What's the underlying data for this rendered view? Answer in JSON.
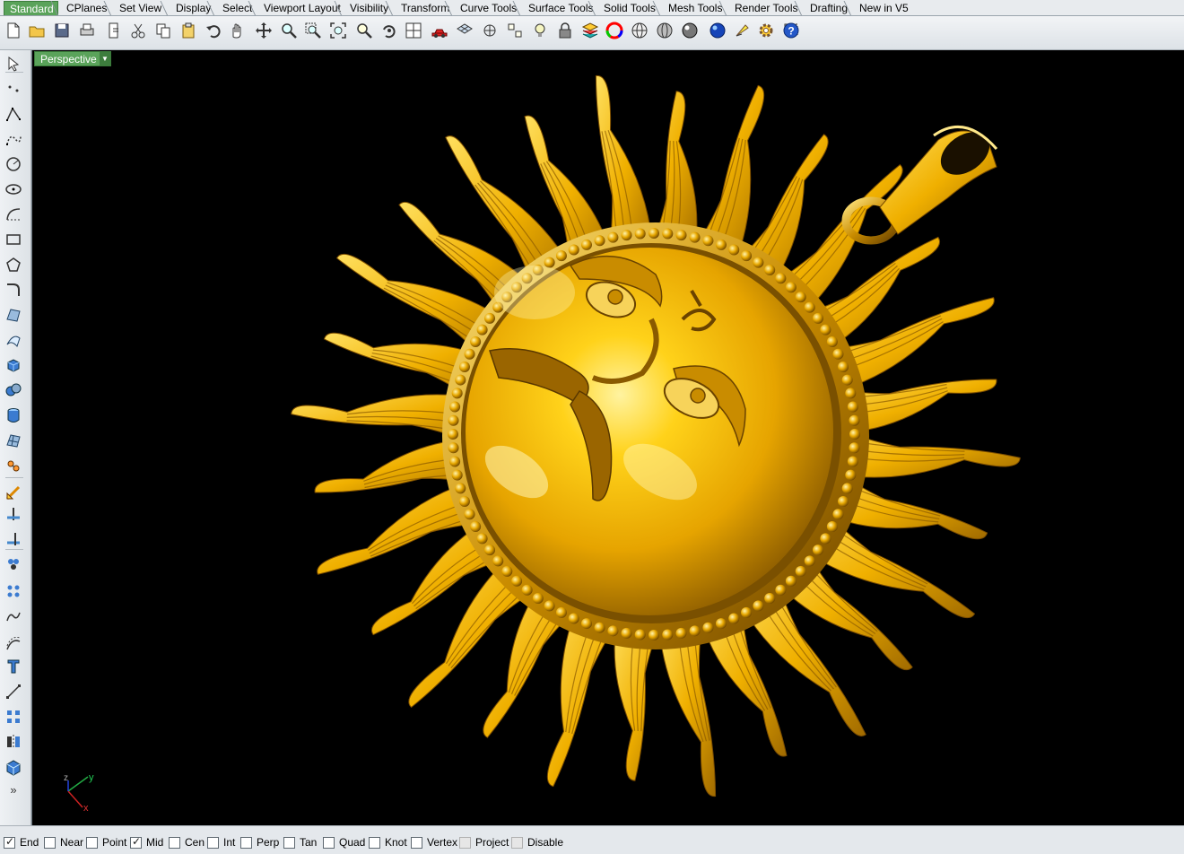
{
  "tabs": [
    {
      "label": "Standard",
      "active": true
    },
    {
      "label": "CPlanes"
    },
    {
      "label": "Set View"
    },
    {
      "label": "Display"
    },
    {
      "label": "Select"
    },
    {
      "label": "Viewport Layout"
    },
    {
      "label": "Visibility"
    },
    {
      "label": "Transform"
    },
    {
      "label": "Curve Tools"
    },
    {
      "label": "Surface Tools"
    },
    {
      "label": "Solid Tools"
    },
    {
      "label": "Mesh Tools"
    },
    {
      "label": "Render Tools"
    },
    {
      "label": "Drafting"
    },
    {
      "label": "New in V5"
    }
  ],
  "toolbar_icons": [
    "new-file-icon",
    "open-folder-icon",
    "save-icon",
    "print-icon",
    "import-icon",
    "cut-icon",
    "copy-icon",
    "paste-icon",
    "undo-icon",
    "pan-hand-icon",
    "rotate-view-icon",
    "zoom-dynamic-icon",
    "zoom-window-icon",
    "zoom-extents-icon",
    "zoom-selected-icon",
    "undo-view-icon",
    "four-viewports-icon",
    "car-icon",
    "grid-icon",
    "cplane-icon",
    "snap-icon",
    "lightbulb-icon",
    "lock-icon",
    "layers-icon",
    "color-wheel-icon",
    "wireframe-sphere-icon",
    "shaded-sphere-icon",
    "rendered-sphere-icon",
    "blue-sphere-icon",
    "light-icon",
    "options-gear-icon",
    "grid-snap-icon",
    "help-icon"
  ],
  "left_icons": [
    "select-arrow-icon",
    "point-icon",
    "polyline-icon",
    "curve-icon",
    "circle-icon",
    "ellipse-icon",
    "arc-icon",
    "rectangle-icon",
    "polygon-icon",
    "fillet-curve-icon",
    "surface-icon",
    "loft-icon",
    "box-icon",
    "boolean-union-icon",
    "cylinder-icon",
    "mesh-icon",
    "transform-icon",
    "edit-points-icon",
    "split-icon",
    "trim-icon",
    "group-icon",
    "explode-icon",
    "join-icon",
    "offset-icon",
    "text-icon",
    "dimension-icon",
    "array-icon",
    "mirror-icon",
    "solid-box-icon",
    "more-icon"
  ],
  "viewport": {
    "title": "Perspective",
    "axis_labels": {
      "x": "x",
      "y": "y",
      "z": "z"
    }
  },
  "osnaps": [
    {
      "label": "End",
      "checked": true
    },
    {
      "label": "Near",
      "checked": false
    },
    {
      "label": "Point",
      "checked": false
    },
    {
      "label": "Mid",
      "checked": true
    },
    {
      "label": "Cen",
      "checked": false
    },
    {
      "label": "Int",
      "checked": false
    },
    {
      "label": "Perp",
      "checked": false
    },
    {
      "label": "Tan",
      "checked": false
    },
    {
      "label": "Quad",
      "checked": false
    },
    {
      "label": "Knot",
      "checked": false
    },
    {
      "label": "Vertex",
      "checked": false
    },
    {
      "label": "Project",
      "checked": false,
      "disabled": true
    },
    {
      "label": "Disable",
      "checked": false,
      "disabled": true
    }
  ],
  "colors": {
    "accent": "#5aa35a",
    "gold": "#f2b705",
    "viewport_bg": "#000000"
  }
}
